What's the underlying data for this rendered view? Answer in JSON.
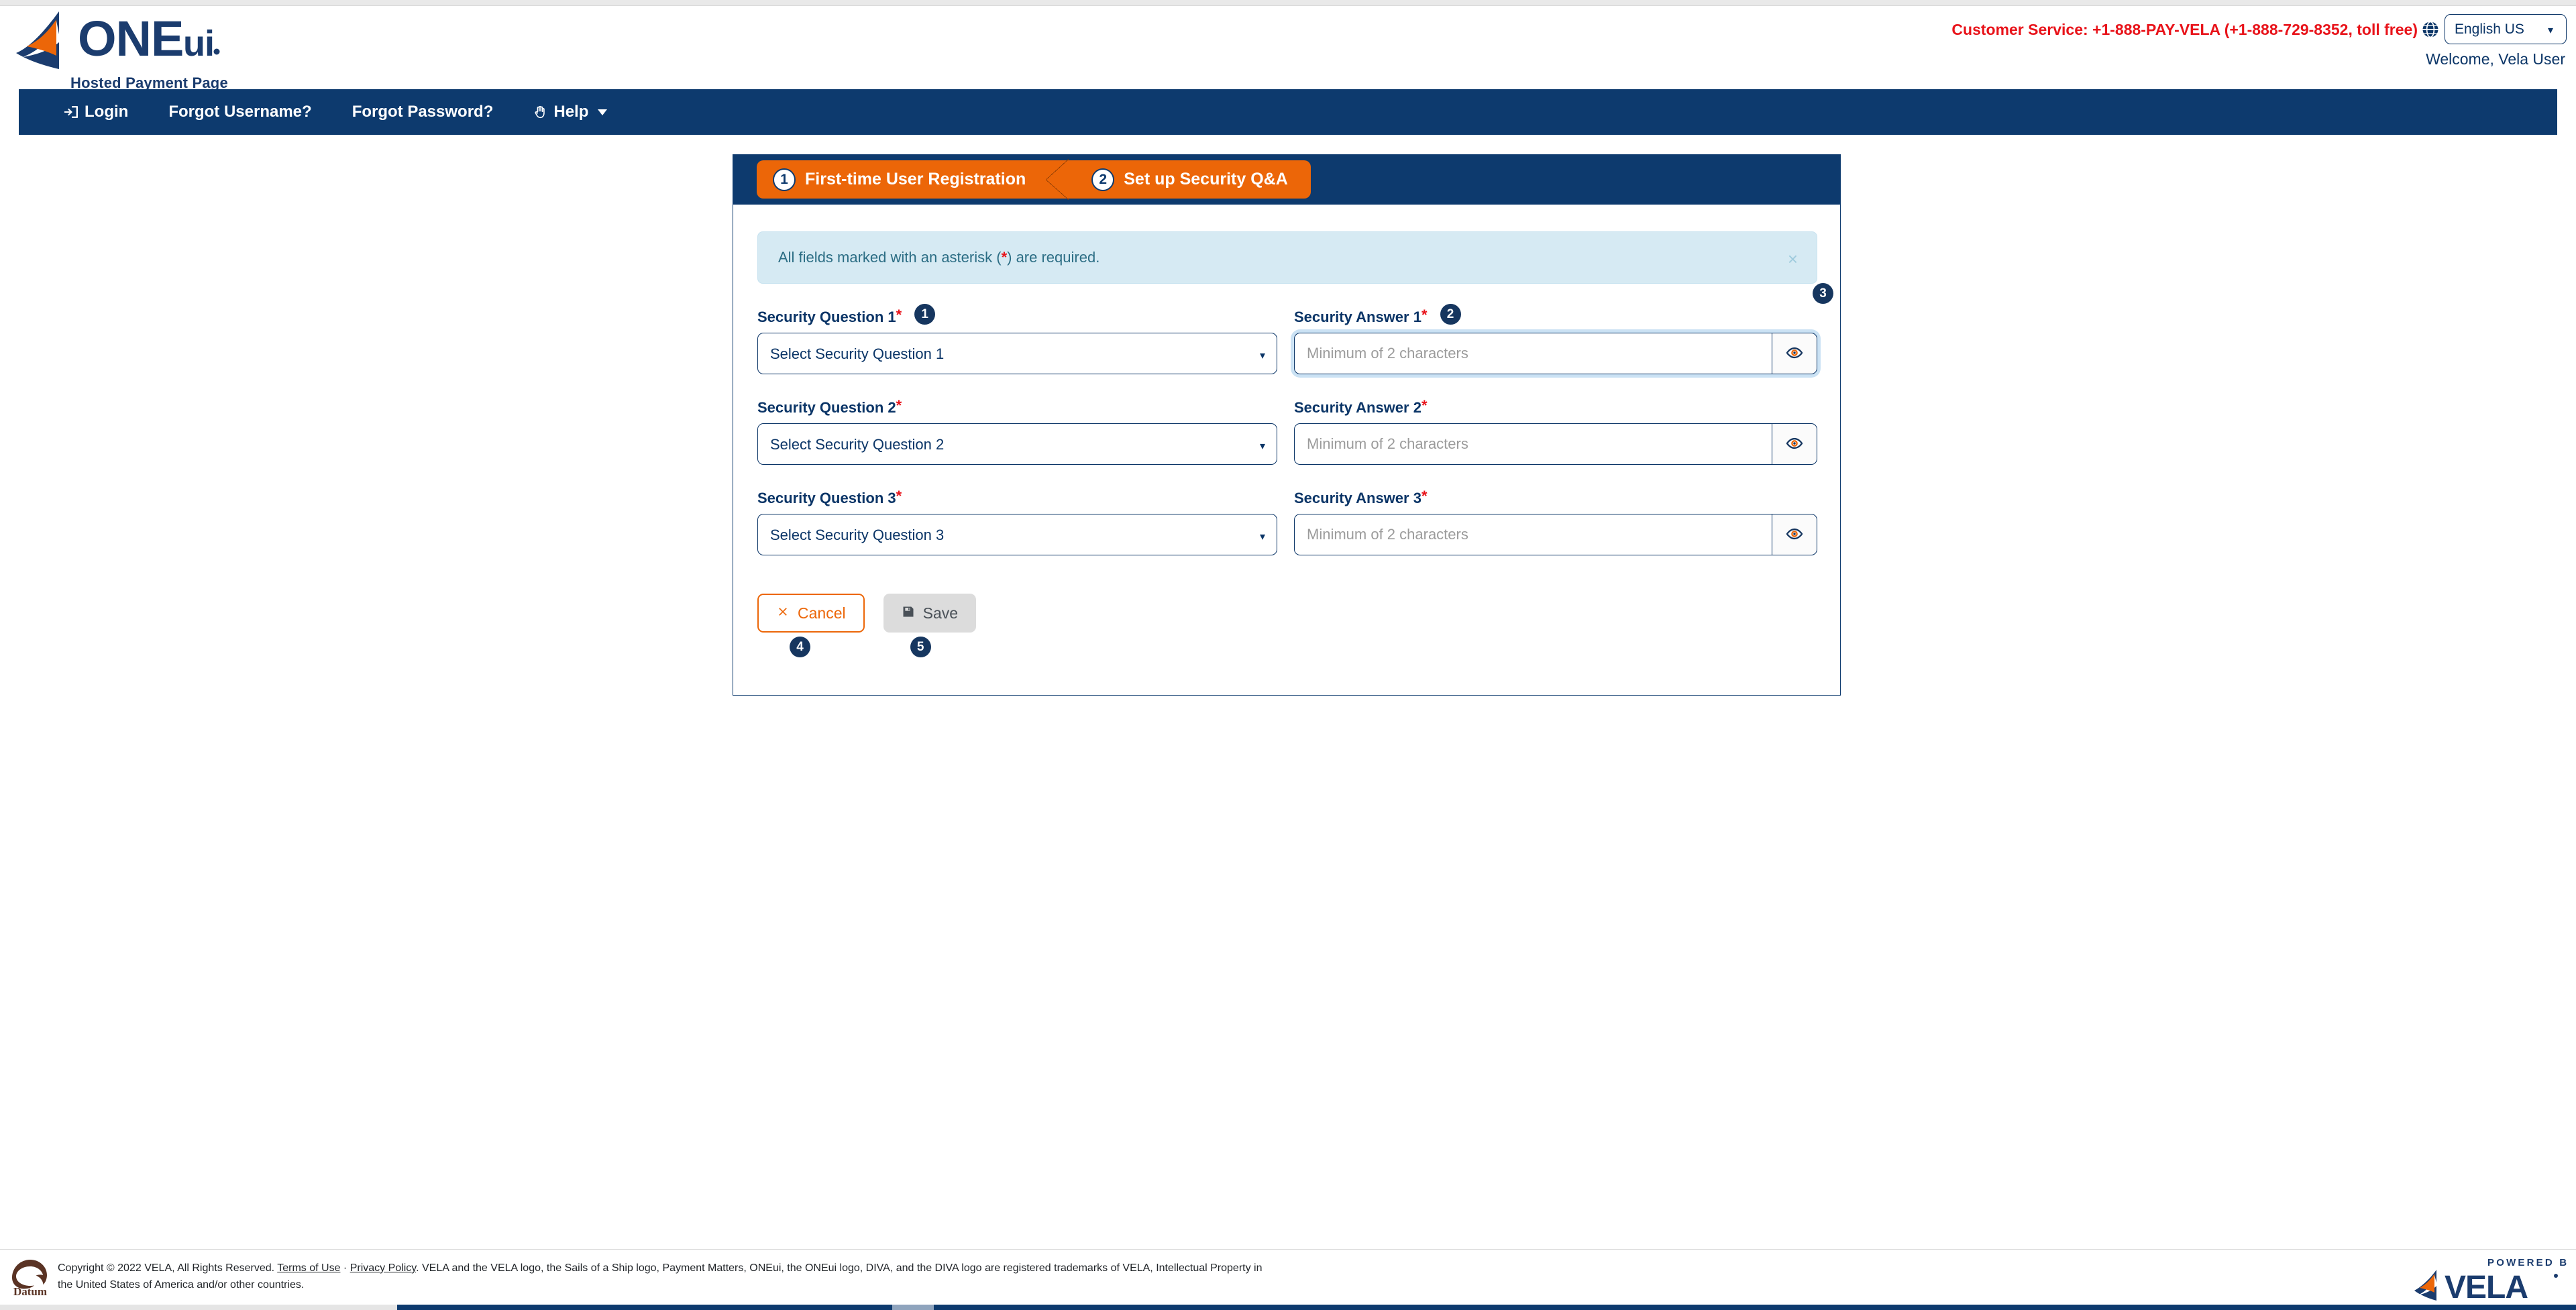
{
  "brand": {
    "logo_name": "oneui-logo",
    "wordmark_one": "ONE",
    "wordmark_ui": "ui",
    "registered": "®",
    "subtitle": "Hosted Payment Page"
  },
  "header": {
    "customer_service": "Customer Service: +1-888-PAY-VELA (+1-888-729-8352, toll free)",
    "globe_icon": "globe-icon",
    "language_selected": "English US",
    "language_options": [
      "English US"
    ],
    "welcome": "Welcome, Vela User"
  },
  "nav": {
    "items": [
      {
        "label": "Login",
        "icon": "login-icon",
        "has_caret": false
      },
      {
        "label": "Forgot Username?",
        "icon": "",
        "has_caret": false
      },
      {
        "label": "Forgot Password?",
        "icon": "",
        "has_caret": false
      },
      {
        "label": "Help",
        "icon": "hand-icon",
        "has_caret": true
      }
    ]
  },
  "wizard": {
    "steps": [
      {
        "number": "1",
        "label": "First-time User Registration"
      },
      {
        "number": "2",
        "label": "Set up Security Q&A"
      }
    ]
  },
  "alert": {
    "prefix": "All fields marked with an asterisk (",
    "asterisk": "*",
    "suffix": ") are required.",
    "close_label": "×"
  },
  "form": {
    "rows": [
      {
        "question_label": "Security Question 1",
        "question_required": "*",
        "question_badge": "1",
        "question_value": "Select Security Question 1",
        "answer_label": "Security Answer 1",
        "answer_required": "*",
        "answer_badge": "2",
        "answer_value": "",
        "answer_placeholder": "Minimum of 2 characters",
        "eye_badge": "3",
        "focused": true
      },
      {
        "question_label": "Security Question 2",
        "question_required": "*",
        "question_badge": "",
        "question_value": "Select Security Question 2",
        "answer_label": "Security Answer 2",
        "answer_required": "*",
        "answer_badge": "",
        "answer_value": "",
        "answer_placeholder": "Minimum of 2 characters",
        "eye_badge": "",
        "focused": false
      },
      {
        "question_label": "Security Question 3",
        "question_required": "*",
        "question_badge": "",
        "question_value": "Select Security Question 3",
        "answer_label": "Security Answer 3",
        "answer_required": "*",
        "answer_badge": "",
        "answer_value": "",
        "answer_placeholder": "Minimum of 2 characters",
        "eye_badge": "",
        "focused": false
      }
    ],
    "eye_icon": "eye-icon"
  },
  "actions": {
    "cancel_label": "Cancel",
    "cancel_icon": "x-mark-icon",
    "cancel_badge": "4",
    "save_label": "Save",
    "save_icon": "floppy-disk-icon",
    "save_badge": "5",
    "save_disabled": true
  },
  "footer": {
    "datum_logo": "datum-logo",
    "copyright_part1": "Copyright © 2022 VELA, All Rights Reserved. ",
    "terms_link": "Terms of Use",
    "separator": " · ",
    "privacy_link": "Privacy Policy",
    "copyright_part2": ". VELA and the VELA logo, the Sails of a Ship logo, Payment Matters, ONEui, the ONEui logo, DIVA, and the DIVA logo are registered trademarks of VELA, Intellectual Property in the United States of America and/or other countries.",
    "powered_by": "POWERED BY",
    "powered_brand": "VELA",
    "powered_registered": "®"
  },
  "colors": {
    "navy": "#0d3a6e",
    "navy_dark": "#16365f",
    "orange": "#ec6608",
    "red": "#e8131a",
    "alert_bg": "#d6eaf3",
    "alert_text": "#2b6d84",
    "disabled_gray": "#dcdcdc",
    "datum_brown": "#5a3324"
  }
}
